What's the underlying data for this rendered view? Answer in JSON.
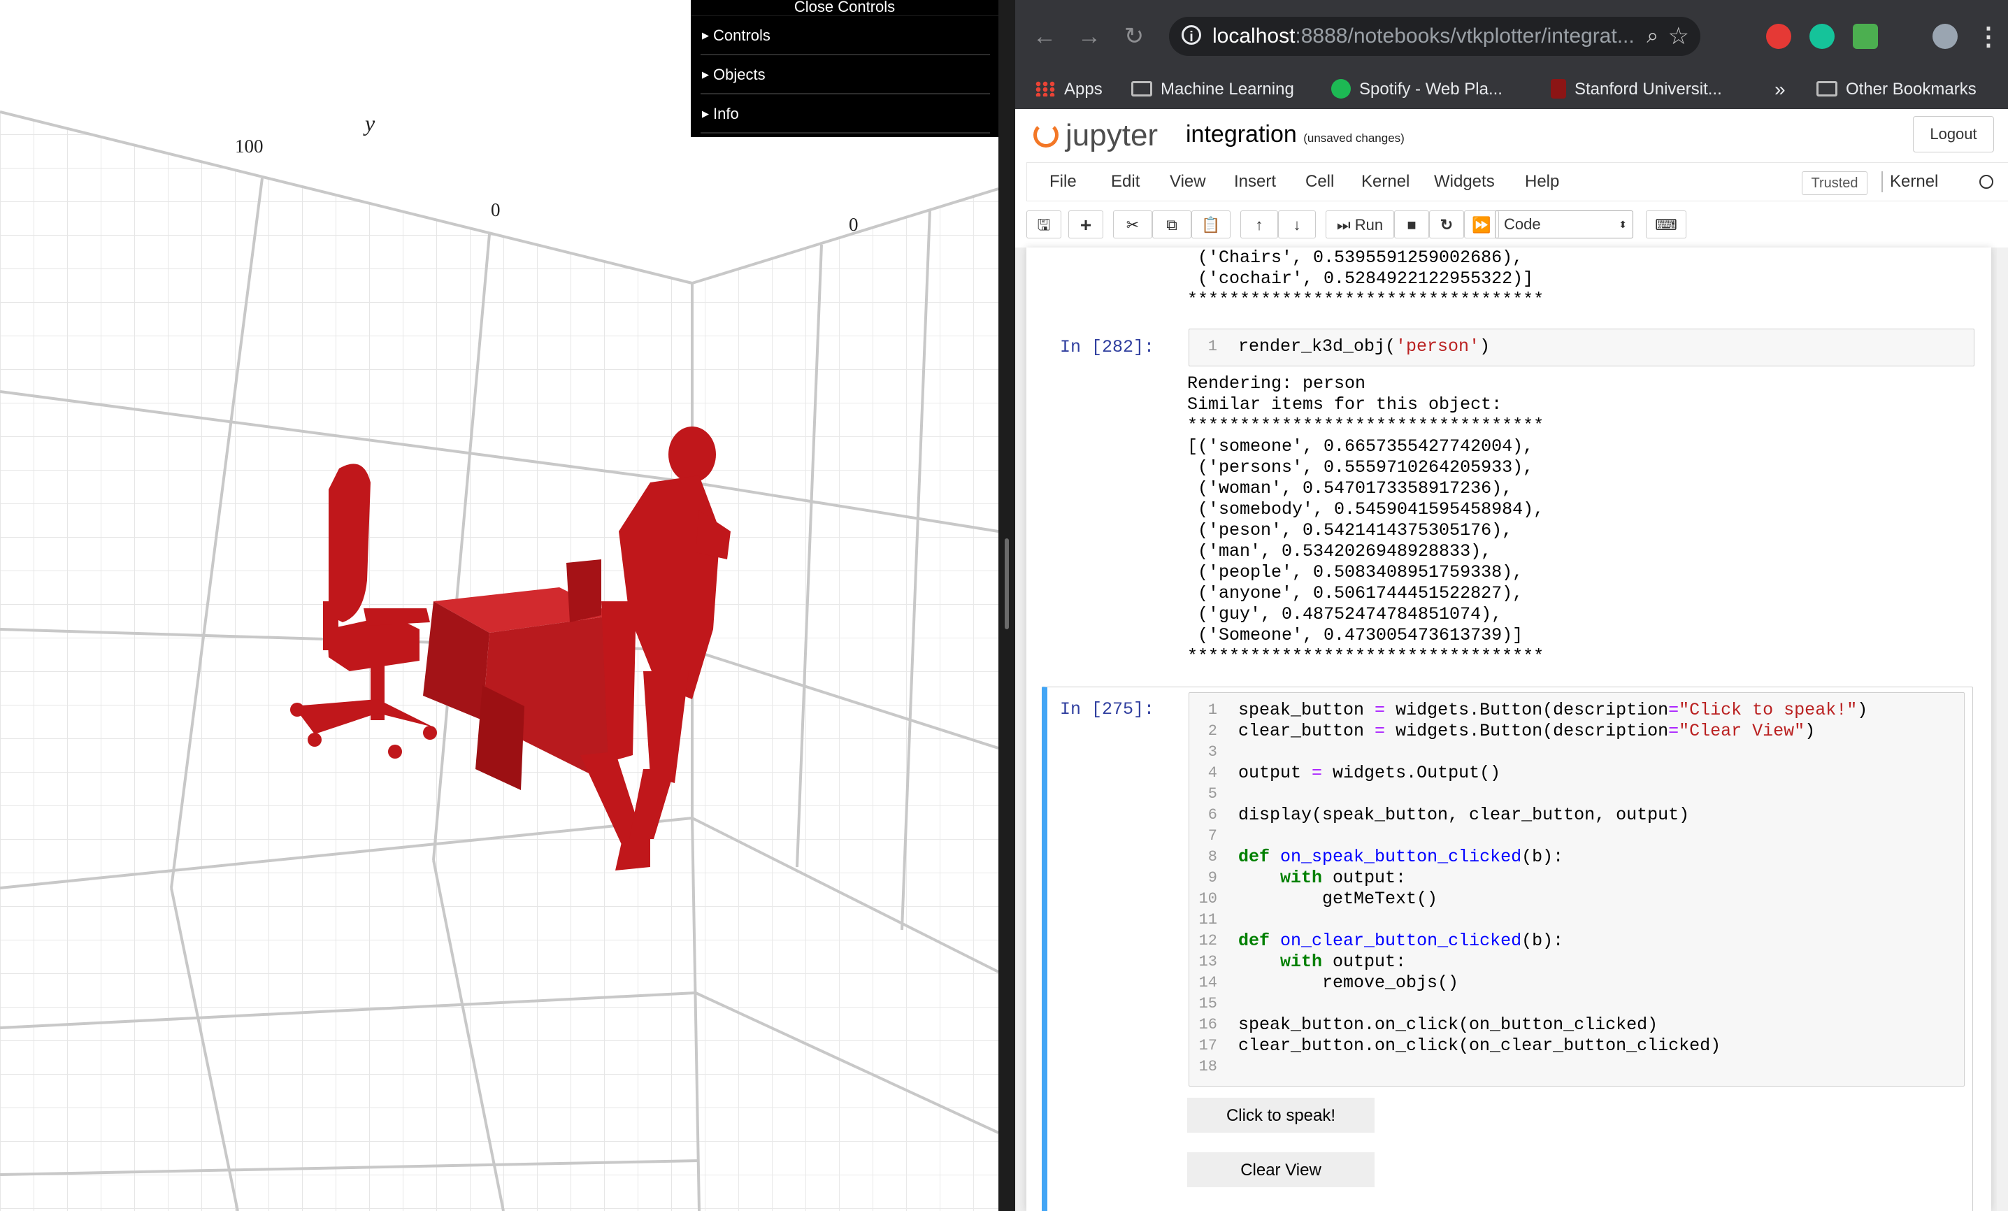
{
  "viewer": {
    "axis_name": "y",
    "tick_100": "100",
    "tick_0a": "0",
    "tick_0b": "0",
    "controls_panel": {
      "close_label": "Close Controls",
      "folders": [
        "Controls",
        "Objects",
        "Info"
      ]
    },
    "model_color": "#c0171b"
  },
  "browser": {
    "url_host": "localhost",
    "url_path": ":8888/notebooks/vtkplotter/integrat...",
    "bookmarks": {
      "apps": "Apps",
      "machine_learning": "Machine Learning",
      "spotify": "Spotify - Web Pla...",
      "stanford": "Stanford Universit...",
      "overflow": "»",
      "other": "Other Bookmarks"
    }
  },
  "jupyter": {
    "logo_text": "jupyter",
    "notebook_name": "integration",
    "unsaved": "(unsaved changes)",
    "logout": "Logout",
    "menu": [
      "File",
      "Edit",
      "View",
      "Insert",
      "Cell",
      "Kernel",
      "Widgets",
      "Help"
    ],
    "trusted": "Trusted",
    "kernel": "Kernel",
    "run_label": "Run",
    "cell_type": "Code",
    "prev_output": [
      " ('Chairs', 0.5395591259002686),",
      " ('cochair', 0.5284922122955322)]",
      "**********************************"
    ],
    "cell_282": {
      "prompt": "In [282]:",
      "line_no": "1",
      "code_prefix": "render_k3d_obj(",
      "code_arg": "'person'",
      "code_suffix": ")",
      "output": [
        "Rendering: person",
        "Similar items for this object:",
        "**********************************",
        "[('someone', 0.6657355427742004),",
        " ('persons', 0.5559710264205933),",
        " ('woman', 0.5470173358917236),",
        " ('somebody', 0.5459041595458984),",
        " ('peson', 0.5421414375305176),",
        " ('man', 0.5342026948928833),",
        " ('people', 0.5083408951759338),",
        " ('anyone', 0.5061744451522827),",
        " ('guy', 0.48752474784851074),",
        " ('Someone', 0.473005473613739)]",
        "**********************************"
      ]
    },
    "cell_275": {
      "prompt": "In [275]:",
      "line_numbers": [
        "1",
        "2",
        "3",
        "4",
        "5",
        "6",
        "7",
        "8",
        "9",
        "10",
        "11",
        "12",
        "13",
        "14",
        "15",
        "16",
        "17",
        "18"
      ],
      "l1a": "speak_button ",
      "l1b": "=",
      "l1c": " widgets.Button(description",
      "l1d": "=",
      "l1e": "\"Click to speak!\"",
      "l1f": ")",
      "l2a": "clear_button ",
      "l2b": "=",
      "l2c": " widgets.Button(description",
      "l2d": "=",
      "l2e": "\"Clear View\"",
      "l2f": ")",
      "l4a": "output ",
      "l4b": "=",
      "l4c": " widgets.Output()",
      "l6": "display(speak_button, clear_button, output)",
      "l8kw": "def",
      "l8fn": "on_speak_button_clicked",
      "l8rest": "(b):",
      "l9kw": "with",
      "l9rest": " output:",
      "l10": "getMeText()",
      "l12kw": "def",
      "l12fn": "on_clear_button_clicked",
      "l12rest": "(b):",
      "l13kw": "with",
      "l13rest": " output:",
      "l14": "remove_objs()",
      "l16": "speak_button.on_click(on_button_clicked)",
      "l17": "clear_button.on_click(on_clear_button_clicked)"
    },
    "widgets": {
      "speak": "Click to speak!",
      "clear": "Clear View"
    }
  }
}
